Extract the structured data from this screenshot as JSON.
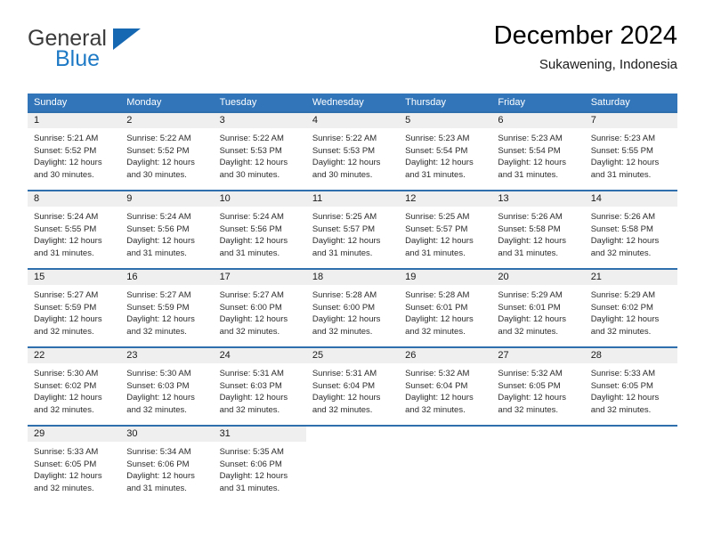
{
  "brand": {
    "name_part1": "General",
    "name_part2": "Blue",
    "accent_color": "#1668b3"
  },
  "header": {
    "title": "December 2024",
    "subtitle": "Sukawening, Indonesia"
  },
  "calendar": {
    "header_bg": "#3275b9",
    "weekday_headers": [
      "Sunday",
      "Monday",
      "Tuesday",
      "Wednesday",
      "Thursday",
      "Friday",
      "Saturday"
    ],
    "weeks": [
      [
        {
          "day": "1",
          "sunrise": "Sunrise: 5:21 AM",
          "sunset": "Sunset: 5:52 PM",
          "daylight1": "Daylight: 12 hours",
          "daylight2": "and 30 minutes."
        },
        {
          "day": "2",
          "sunrise": "Sunrise: 5:22 AM",
          "sunset": "Sunset: 5:52 PM",
          "daylight1": "Daylight: 12 hours",
          "daylight2": "and 30 minutes."
        },
        {
          "day": "3",
          "sunrise": "Sunrise: 5:22 AM",
          "sunset": "Sunset: 5:53 PM",
          "daylight1": "Daylight: 12 hours",
          "daylight2": "and 30 minutes."
        },
        {
          "day": "4",
          "sunrise": "Sunrise: 5:22 AM",
          "sunset": "Sunset: 5:53 PM",
          "daylight1": "Daylight: 12 hours",
          "daylight2": "and 30 minutes."
        },
        {
          "day": "5",
          "sunrise": "Sunrise: 5:23 AM",
          "sunset": "Sunset: 5:54 PM",
          "daylight1": "Daylight: 12 hours",
          "daylight2": "and 31 minutes."
        },
        {
          "day": "6",
          "sunrise": "Sunrise: 5:23 AM",
          "sunset": "Sunset: 5:54 PM",
          "daylight1": "Daylight: 12 hours",
          "daylight2": "and 31 minutes."
        },
        {
          "day": "7",
          "sunrise": "Sunrise: 5:23 AM",
          "sunset": "Sunset: 5:55 PM",
          "daylight1": "Daylight: 12 hours",
          "daylight2": "and 31 minutes."
        }
      ],
      [
        {
          "day": "8",
          "sunrise": "Sunrise: 5:24 AM",
          "sunset": "Sunset: 5:55 PM",
          "daylight1": "Daylight: 12 hours",
          "daylight2": "and 31 minutes."
        },
        {
          "day": "9",
          "sunrise": "Sunrise: 5:24 AM",
          "sunset": "Sunset: 5:56 PM",
          "daylight1": "Daylight: 12 hours",
          "daylight2": "and 31 minutes."
        },
        {
          "day": "10",
          "sunrise": "Sunrise: 5:24 AM",
          "sunset": "Sunset: 5:56 PM",
          "daylight1": "Daylight: 12 hours",
          "daylight2": "and 31 minutes."
        },
        {
          "day": "11",
          "sunrise": "Sunrise: 5:25 AM",
          "sunset": "Sunset: 5:57 PM",
          "daylight1": "Daylight: 12 hours",
          "daylight2": "and 31 minutes."
        },
        {
          "day": "12",
          "sunrise": "Sunrise: 5:25 AM",
          "sunset": "Sunset: 5:57 PM",
          "daylight1": "Daylight: 12 hours",
          "daylight2": "and 31 minutes."
        },
        {
          "day": "13",
          "sunrise": "Sunrise: 5:26 AM",
          "sunset": "Sunset: 5:58 PM",
          "daylight1": "Daylight: 12 hours",
          "daylight2": "and 31 minutes."
        },
        {
          "day": "14",
          "sunrise": "Sunrise: 5:26 AM",
          "sunset": "Sunset: 5:58 PM",
          "daylight1": "Daylight: 12 hours",
          "daylight2": "and 32 minutes."
        }
      ],
      [
        {
          "day": "15",
          "sunrise": "Sunrise: 5:27 AM",
          "sunset": "Sunset: 5:59 PM",
          "daylight1": "Daylight: 12 hours",
          "daylight2": "and 32 minutes."
        },
        {
          "day": "16",
          "sunrise": "Sunrise: 5:27 AM",
          "sunset": "Sunset: 5:59 PM",
          "daylight1": "Daylight: 12 hours",
          "daylight2": "and 32 minutes."
        },
        {
          "day": "17",
          "sunrise": "Sunrise: 5:27 AM",
          "sunset": "Sunset: 6:00 PM",
          "daylight1": "Daylight: 12 hours",
          "daylight2": "and 32 minutes."
        },
        {
          "day": "18",
          "sunrise": "Sunrise: 5:28 AM",
          "sunset": "Sunset: 6:00 PM",
          "daylight1": "Daylight: 12 hours",
          "daylight2": "and 32 minutes."
        },
        {
          "day": "19",
          "sunrise": "Sunrise: 5:28 AM",
          "sunset": "Sunset: 6:01 PM",
          "daylight1": "Daylight: 12 hours",
          "daylight2": "and 32 minutes."
        },
        {
          "day": "20",
          "sunrise": "Sunrise: 5:29 AM",
          "sunset": "Sunset: 6:01 PM",
          "daylight1": "Daylight: 12 hours",
          "daylight2": "and 32 minutes."
        },
        {
          "day": "21",
          "sunrise": "Sunrise: 5:29 AM",
          "sunset": "Sunset: 6:02 PM",
          "daylight1": "Daylight: 12 hours",
          "daylight2": "and 32 minutes."
        }
      ],
      [
        {
          "day": "22",
          "sunrise": "Sunrise: 5:30 AM",
          "sunset": "Sunset: 6:02 PM",
          "daylight1": "Daylight: 12 hours",
          "daylight2": "and 32 minutes."
        },
        {
          "day": "23",
          "sunrise": "Sunrise: 5:30 AM",
          "sunset": "Sunset: 6:03 PM",
          "daylight1": "Daylight: 12 hours",
          "daylight2": "and 32 minutes."
        },
        {
          "day": "24",
          "sunrise": "Sunrise: 5:31 AM",
          "sunset": "Sunset: 6:03 PM",
          "daylight1": "Daylight: 12 hours",
          "daylight2": "and 32 minutes."
        },
        {
          "day": "25",
          "sunrise": "Sunrise: 5:31 AM",
          "sunset": "Sunset: 6:04 PM",
          "daylight1": "Daylight: 12 hours",
          "daylight2": "and 32 minutes."
        },
        {
          "day": "26",
          "sunrise": "Sunrise: 5:32 AM",
          "sunset": "Sunset: 6:04 PM",
          "daylight1": "Daylight: 12 hours",
          "daylight2": "and 32 minutes."
        },
        {
          "day": "27",
          "sunrise": "Sunrise: 5:32 AM",
          "sunset": "Sunset: 6:05 PM",
          "daylight1": "Daylight: 12 hours",
          "daylight2": "and 32 minutes."
        },
        {
          "day": "28",
          "sunrise": "Sunrise: 5:33 AM",
          "sunset": "Sunset: 6:05 PM",
          "daylight1": "Daylight: 12 hours",
          "daylight2": "and 32 minutes."
        }
      ],
      [
        {
          "day": "29",
          "sunrise": "Sunrise: 5:33 AM",
          "sunset": "Sunset: 6:05 PM",
          "daylight1": "Daylight: 12 hours",
          "daylight2": "and 32 minutes."
        },
        {
          "day": "30",
          "sunrise": "Sunrise: 5:34 AM",
          "sunset": "Sunset: 6:06 PM",
          "daylight1": "Daylight: 12 hours",
          "daylight2": "and 31 minutes."
        },
        {
          "day": "31",
          "sunrise": "Sunrise: 5:35 AM",
          "sunset": "Sunset: 6:06 PM",
          "daylight1": "Daylight: 12 hours",
          "daylight2": "and 31 minutes."
        },
        {
          "day": "",
          "sunrise": "",
          "sunset": "",
          "daylight1": "",
          "daylight2": ""
        },
        {
          "day": "",
          "sunrise": "",
          "sunset": "",
          "daylight1": "",
          "daylight2": ""
        },
        {
          "day": "",
          "sunrise": "",
          "sunset": "",
          "daylight1": "",
          "daylight2": ""
        },
        {
          "day": "",
          "sunrise": "",
          "sunset": "",
          "daylight1": "",
          "daylight2": ""
        }
      ]
    ]
  }
}
